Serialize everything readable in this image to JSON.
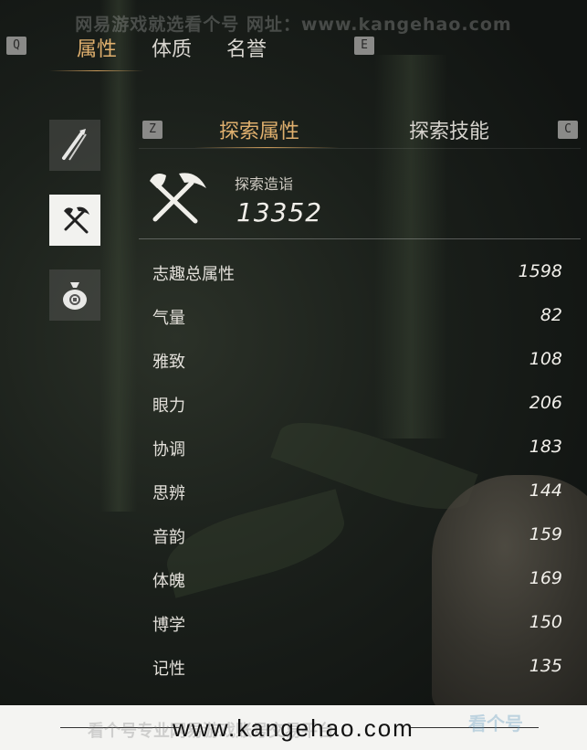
{
  "watermark": {
    "top": "网易游戏就选看个号  网址：www.kangehao.com",
    "footer_ghost": "看个号专业网易游戏账号交易平台",
    "footer_logo": "看个号"
  },
  "keys": {
    "prev_tab": "Q",
    "next_tab": "E",
    "prev_sub": "Z",
    "next_sub": "C"
  },
  "top_tabs": [
    {
      "label": "属性",
      "active": true
    },
    {
      "label": "体质",
      "active": false
    },
    {
      "label": "名誉",
      "active": false
    }
  ],
  "side_nav": [
    {
      "icon": "sword-brush-icon",
      "active": false
    },
    {
      "icon": "shovel-pickaxe-icon",
      "active": true
    },
    {
      "icon": "money-bag-icon",
      "active": false
    }
  ],
  "sub_tabs": [
    {
      "label": "探索属性",
      "active": true
    },
    {
      "label": "探索技能",
      "active": false
    }
  ],
  "explore": {
    "icon": "shovel-pickaxe-icon",
    "label": "探索造诣",
    "value": "13352"
  },
  "stats": [
    {
      "name": "志趣总属性",
      "value": "1598"
    },
    {
      "name": "气量",
      "value": "82"
    },
    {
      "name": "雅致",
      "value": "108"
    },
    {
      "name": "眼力",
      "value": "206"
    },
    {
      "name": "协调",
      "value": "183"
    },
    {
      "name": "思辨",
      "value": "144"
    },
    {
      "name": "音韵",
      "value": "159"
    },
    {
      "name": "体魄",
      "value": "169"
    },
    {
      "name": "博学",
      "value": "150"
    },
    {
      "name": "记性",
      "value": "135"
    }
  ],
  "footer": {
    "url": "www.kangehao.com"
  },
  "colors": {
    "accent": "#e0b06e",
    "text": "#e3e0da"
  }
}
